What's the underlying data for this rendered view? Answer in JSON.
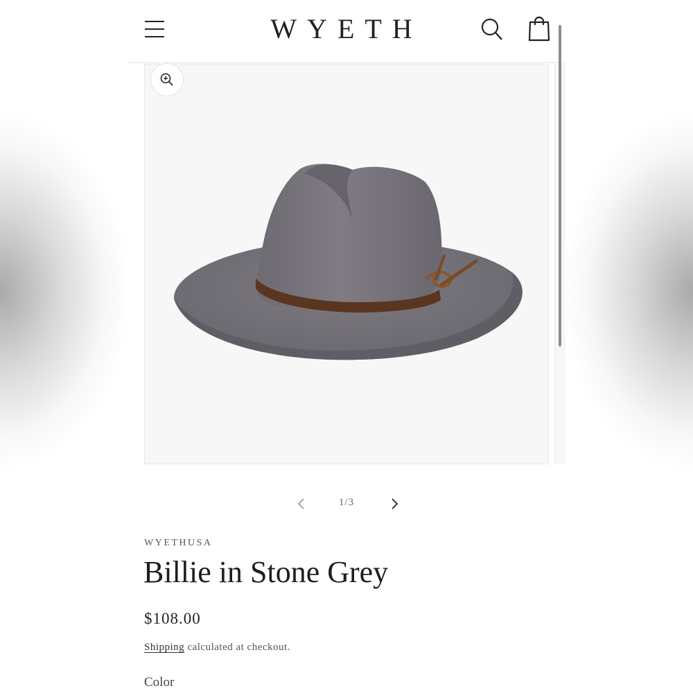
{
  "header": {
    "logo": "WYETH",
    "menu_icon": "hamburger-menu-icon",
    "search_icon": "search-icon",
    "cart_icon": "shopping-bag-icon"
  },
  "gallery": {
    "zoom_icon": "zoom-in-icon",
    "counter": "1/3",
    "prev_icon": "chevron-left-icon",
    "next_icon": "chevron-right-icon"
  },
  "product": {
    "vendor": "WYETHUSA",
    "title": "Billie in Stone Grey",
    "price": "$108.00",
    "shipping_link": "Shipping",
    "shipping_text": " calculated at checkout.",
    "color_label": "Color"
  },
  "colors": {
    "hat": "#76737a",
    "band": "#5a3520",
    "accent_text": "#1f1f1f"
  }
}
